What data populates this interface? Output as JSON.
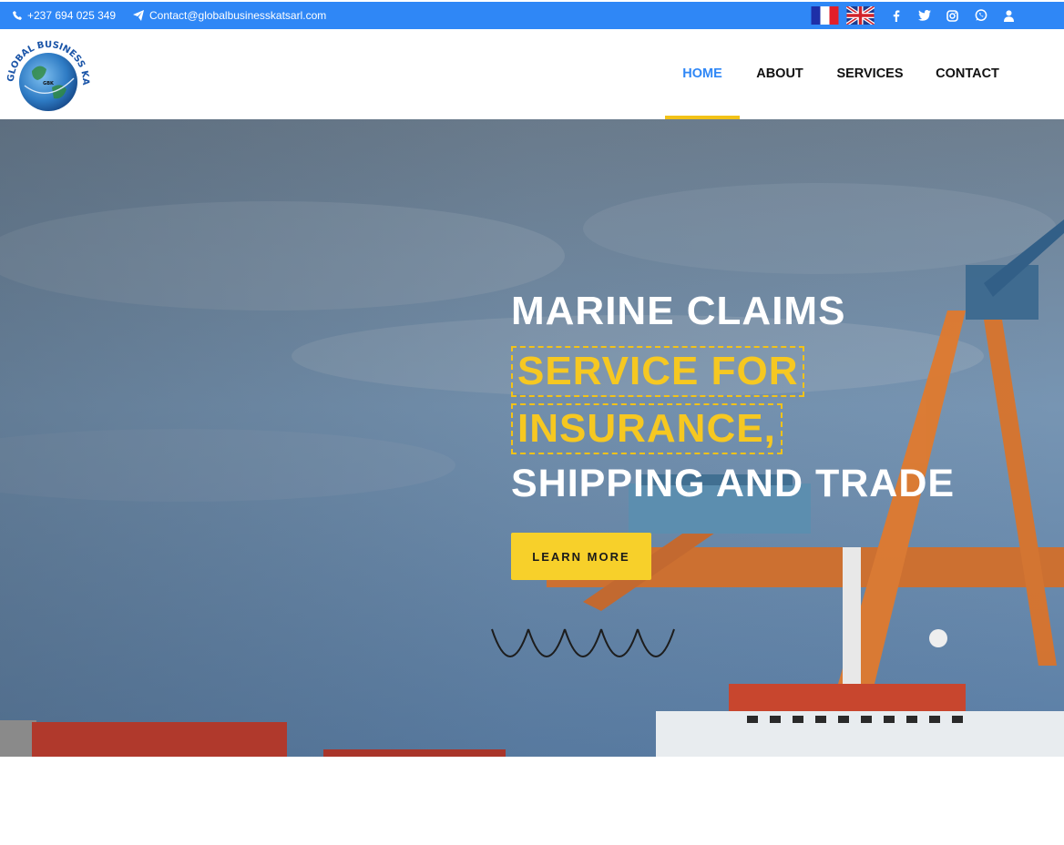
{
  "topbar": {
    "phone": "+237 694 025 349",
    "email": "Contact@globalbusinesskatsarl.com",
    "social_icons": [
      "facebook-icon",
      "twitter-icon",
      "instagram-icon",
      "whatsapp-icon",
      "user-icon"
    ]
  },
  "brand": {
    "logo_text": "GLOBAL BUSINESS KAT Sarl",
    "logo_center": "GBK"
  },
  "nav": {
    "items": [
      {
        "label": "HOME",
        "active": true
      },
      {
        "label": "ABOUT",
        "active": false
      },
      {
        "label": "SERVICES",
        "active": false
      },
      {
        "label": "CONTACT",
        "active": false
      }
    ]
  },
  "hero": {
    "line1": "MARINE CLAIMS",
    "line2": "SERVICE FOR",
    "line3": "INSURANCE,",
    "line4": "SHIPPING AND TRADE",
    "button": "LEARN MORE"
  },
  "colors": {
    "topbar": "#2f87f6",
    "accent": "#f2c218",
    "nav_active": "#2f87f6"
  }
}
